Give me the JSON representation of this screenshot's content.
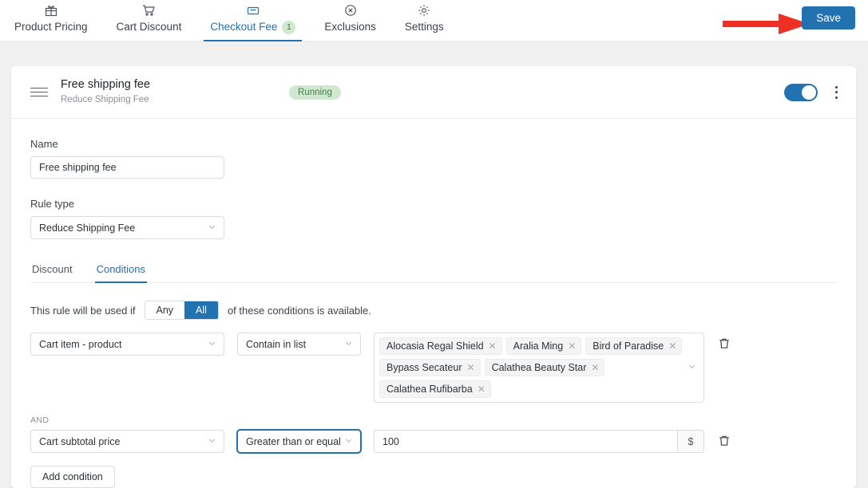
{
  "topbar": {
    "tabs": [
      {
        "label": "Product Pricing",
        "icon": "gift-icon",
        "active": false,
        "badge": null
      },
      {
        "label": "Cart Discount",
        "icon": "cart-icon",
        "active": false,
        "badge": null
      },
      {
        "label": "Checkout Fee",
        "icon": "checkout-icon",
        "active": true,
        "badge": "1"
      },
      {
        "label": "Exclusions",
        "icon": "circle-x-icon",
        "active": false,
        "badge": null
      },
      {
        "label": "Settings",
        "icon": "gear-icon",
        "active": false,
        "badge": null
      }
    ],
    "save_label": "Save",
    "accent_color": "#2271b1",
    "arrow_color": "#ee3124"
  },
  "card": {
    "title": "Free shipping fee",
    "subtitle": "Reduce Shipping Fee",
    "status": "Running",
    "status_bg": "#cfe8cf",
    "status_color": "#4b7a4b",
    "toggle_on": true
  },
  "form": {
    "name_label": "Name",
    "name_value": "Free shipping fee",
    "rule_type_label": "Rule type",
    "rule_type_value": "Reduce Shipping Fee"
  },
  "inner_tabs": [
    {
      "label": "Discount",
      "active": false
    },
    {
      "label": "Conditions",
      "active": true
    }
  ],
  "rule": {
    "prefix": "This rule will be used if",
    "options": [
      "Any",
      "All"
    ],
    "selected": "All",
    "suffix": "of these conditions is available."
  },
  "conditions": [
    {
      "field": "Cart item - product",
      "operator": "Contain in list",
      "tags": [
        "Alocasia Regal Shield",
        "Aralia Ming",
        "Bird of Paradise",
        "Bypass Secateur",
        "Calathea Beauty Star",
        "Calathea Rufibarba"
      ]
    },
    {
      "joiner": "AND",
      "field": "Cart subtotal price",
      "operator": "Greater than or equal",
      "value": "100",
      "suffix": "$"
    }
  ],
  "add_condition_label": "Add condition"
}
